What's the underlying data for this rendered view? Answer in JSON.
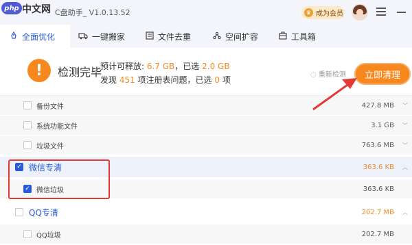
{
  "app": {
    "watermark_php": "php",
    "watermark_cn": "中文网",
    "title": "C盘助手_ V1.0.13.52",
    "vip_label": "成为会员"
  },
  "tabs": [
    {
      "label": "全面优化",
      "icon": "rocket-icon",
      "active": true
    },
    {
      "label": "一键搬家",
      "icon": "truck-icon",
      "active": false
    },
    {
      "label": "文件去重",
      "icon": "files-icon",
      "active": false
    },
    {
      "label": "空间扩容",
      "icon": "network-icon",
      "active": false
    },
    {
      "label": "工具箱",
      "icon": "toolbox-icon",
      "active": false
    }
  ],
  "summary": {
    "status": "检测完毕",
    "l1_a": "预计可释放: ",
    "freeable": "6.7 GB",
    "l1_b": "，已选 ",
    "selected": "2.0 GB",
    "l2_a": "发现 ",
    "registry_count": "451",
    "l2_b": " 项注册表问题，已选 ",
    "registry_selected": "0",
    "l2_c": " 项",
    "rescan": "重新检测",
    "clean_button": "立即清理"
  },
  "items": [
    {
      "label": "备份文件",
      "size": "427.8 MB",
      "checked": false
    },
    {
      "label": "系统功能文件",
      "size": "3.1 GB",
      "checked": false
    },
    {
      "label": "垃圾文件",
      "size": "763.6 MB",
      "checked": false
    },
    {
      "label": "微信专清",
      "size": "363.6 KB",
      "checked": true
    },
    {
      "label": "微信垃圾",
      "size": "363.6 KB",
      "checked": true
    },
    {
      "label": "QQ专清",
      "size": "202.7 MB",
      "checked": false
    },
    {
      "label": "QQ垃圾",
      "size": "202.7 MB",
      "checked": false
    }
  ],
  "colors": {
    "accent": "#2a5bd7",
    "orange": "#f6881f",
    "annotation_red": "#e53935"
  }
}
